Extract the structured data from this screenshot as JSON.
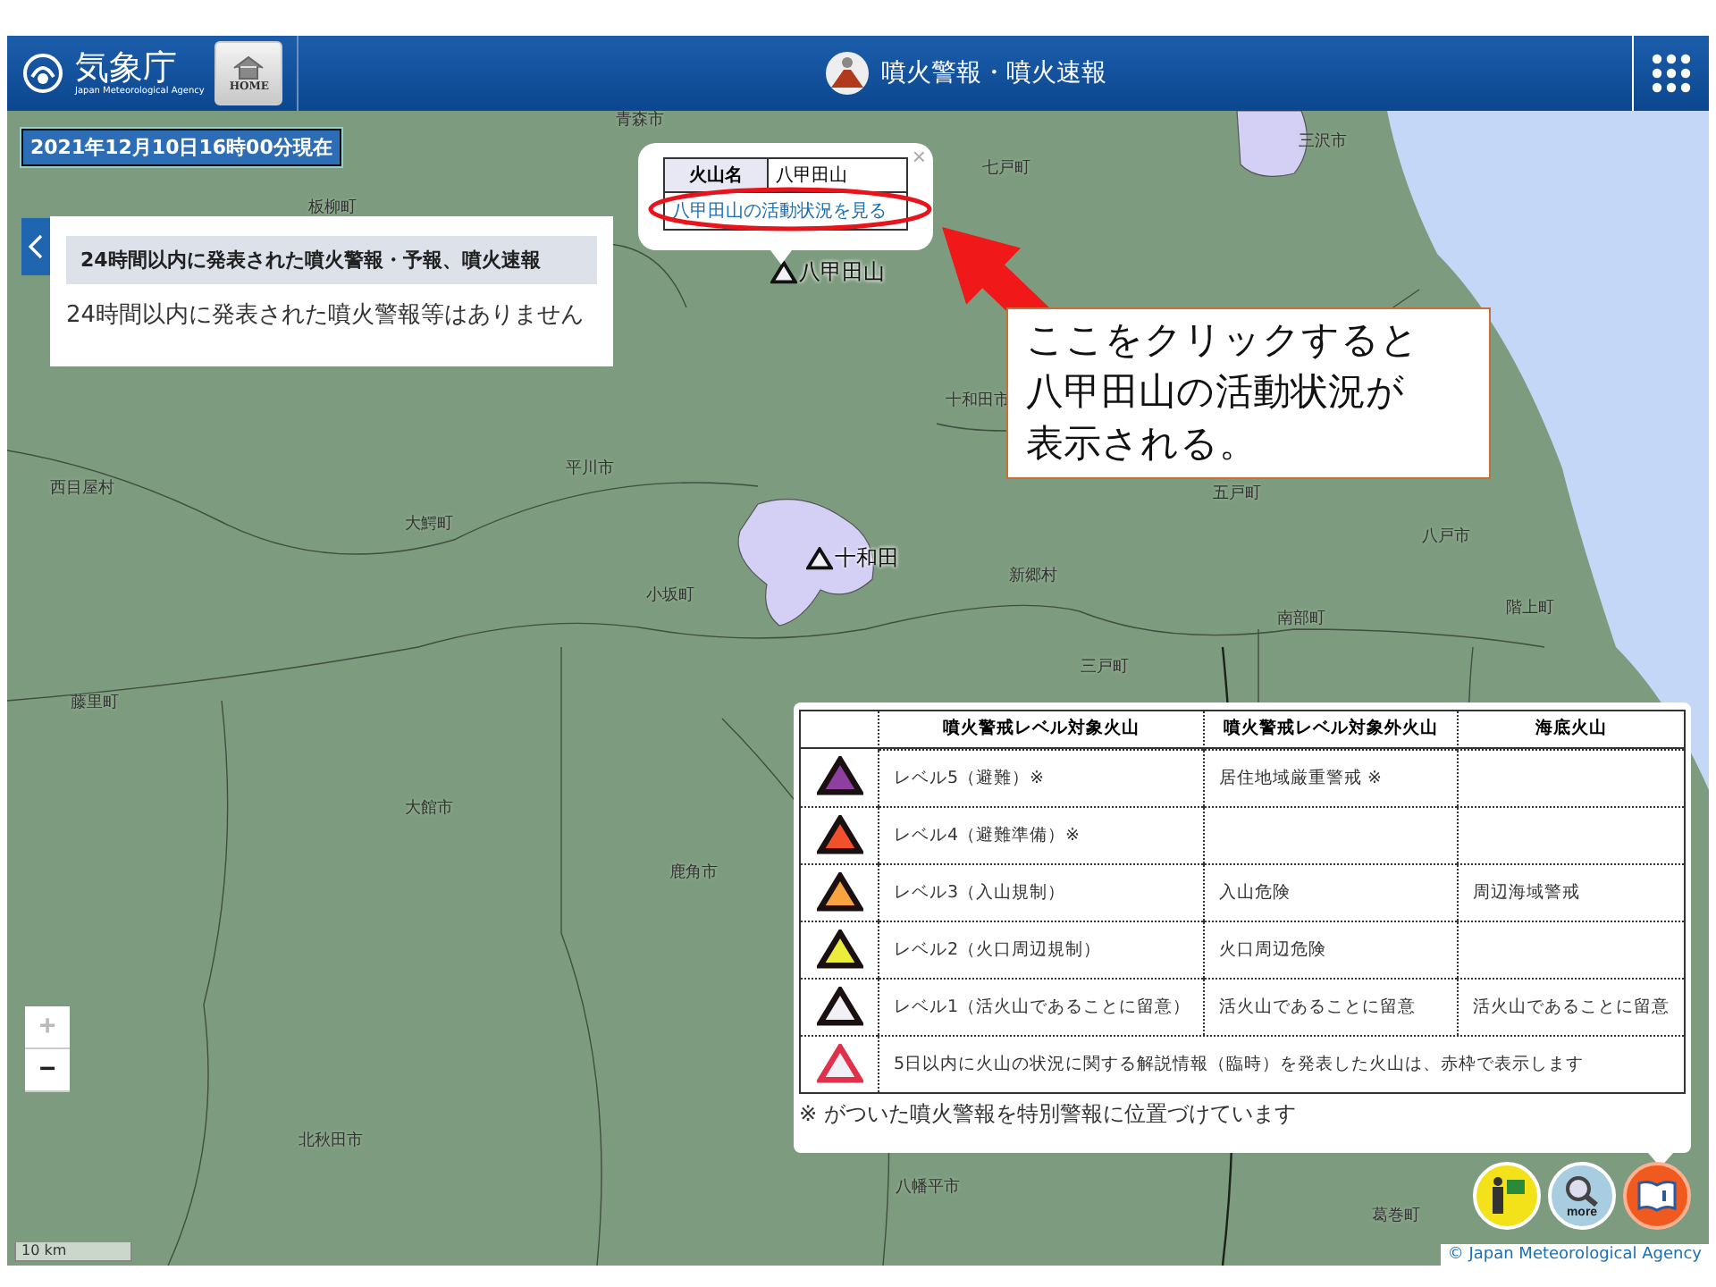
{
  "header": {
    "logo_text": "気象庁",
    "logo_subtext": "Japan Meteorological Agency",
    "home_label": "HOME",
    "title": "噴火警報・噴火速報"
  },
  "timestamp": "2021年12月10日16時00分現在",
  "side_panel": {
    "expanded": true,
    "heading": "24時間以内に発表された噴火警報・予報、噴火速報",
    "message": "24時間以内に発表された噴火警報等はありません"
  },
  "places": [
    {
      "name": "青森市"
    },
    {
      "name": "七戸町"
    },
    {
      "name": "三沢市"
    },
    {
      "name": "板柳町"
    },
    {
      "name": "十和田市"
    },
    {
      "name": "西目屋村"
    },
    {
      "name": "平川市"
    },
    {
      "name": "大鰐町"
    },
    {
      "name": "五戸町"
    },
    {
      "name": "八戸市"
    },
    {
      "name": "新郷村"
    },
    {
      "name": "南部町"
    },
    {
      "name": "階上町"
    },
    {
      "name": "小坂町"
    },
    {
      "name": "三戸町"
    },
    {
      "name": "藤里町"
    },
    {
      "name": "大館市"
    },
    {
      "name": "鹿角市"
    },
    {
      "name": "北秋田市"
    },
    {
      "name": "八幡平市"
    },
    {
      "name": "葛巻町"
    }
  ],
  "volcanoes": [
    {
      "name": "八甲田山",
      "color": "#f0f0f5"
    },
    {
      "name": "十和田",
      "color": "#f0f0f5"
    }
  ],
  "popup": {
    "close": "×",
    "label": "火山名",
    "value": "八甲田山",
    "link": "八甲田山の活動状況を見る"
  },
  "annotation": {
    "lines": [
      "ここをクリックすると",
      "八甲田山の活動状況が",
      "表示される。"
    ]
  },
  "legend": {
    "columns": [
      "噴火警戒レベル対象火山",
      "噴火警戒レベル対象外火山",
      "海底火山"
    ],
    "rows": [
      {
        "kind": "level",
        "color": "#8e3fa0",
        "cells": [
          "レベル5（避難）※",
          "居住地域厳重警戒 ※",
          ""
        ]
      },
      {
        "kind": "level",
        "color": "#f0502a",
        "cells": [
          "レベル4（避難準備）※",
          "",
          ""
        ]
      },
      {
        "kind": "level",
        "color": "#f7a440",
        "cells": [
          "レベル3（入山規制）",
          "入山危険",
          "周辺海域警戒"
        ]
      },
      {
        "kind": "level",
        "color": "#ecec3c",
        "cells": [
          "レベル2（火口周辺規制）",
          "火口周辺危険",
          ""
        ]
      },
      {
        "kind": "level",
        "color": "#f0f0f5",
        "cells": [
          "レベル1（活火山であることに留意）",
          "活火山であることに留意",
          "活火山であることに留意"
        ]
      },
      {
        "kind": "note",
        "color": "#e0304a",
        "cells": [
          "5日以内に火山の状況に関する解説情報（臨時）を発表した火山は、赤枠で表示します"
        ]
      }
    ],
    "footnote": "※ がついた噴火警報を特別警報に位置づけています"
  },
  "zoom": [
    {
      "label": "+",
      "disabled": true
    },
    {
      "label": "−",
      "disabled": false
    }
  ],
  "scale": "10 km",
  "copyright": "© Japan Meteorological Agency",
  "tools": [
    {
      "kind": "guide",
      "selected": false
    },
    {
      "kind": "more",
      "label": "more",
      "selected": false
    },
    {
      "kind": "legend",
      "selected": true
    }
  ]
}
